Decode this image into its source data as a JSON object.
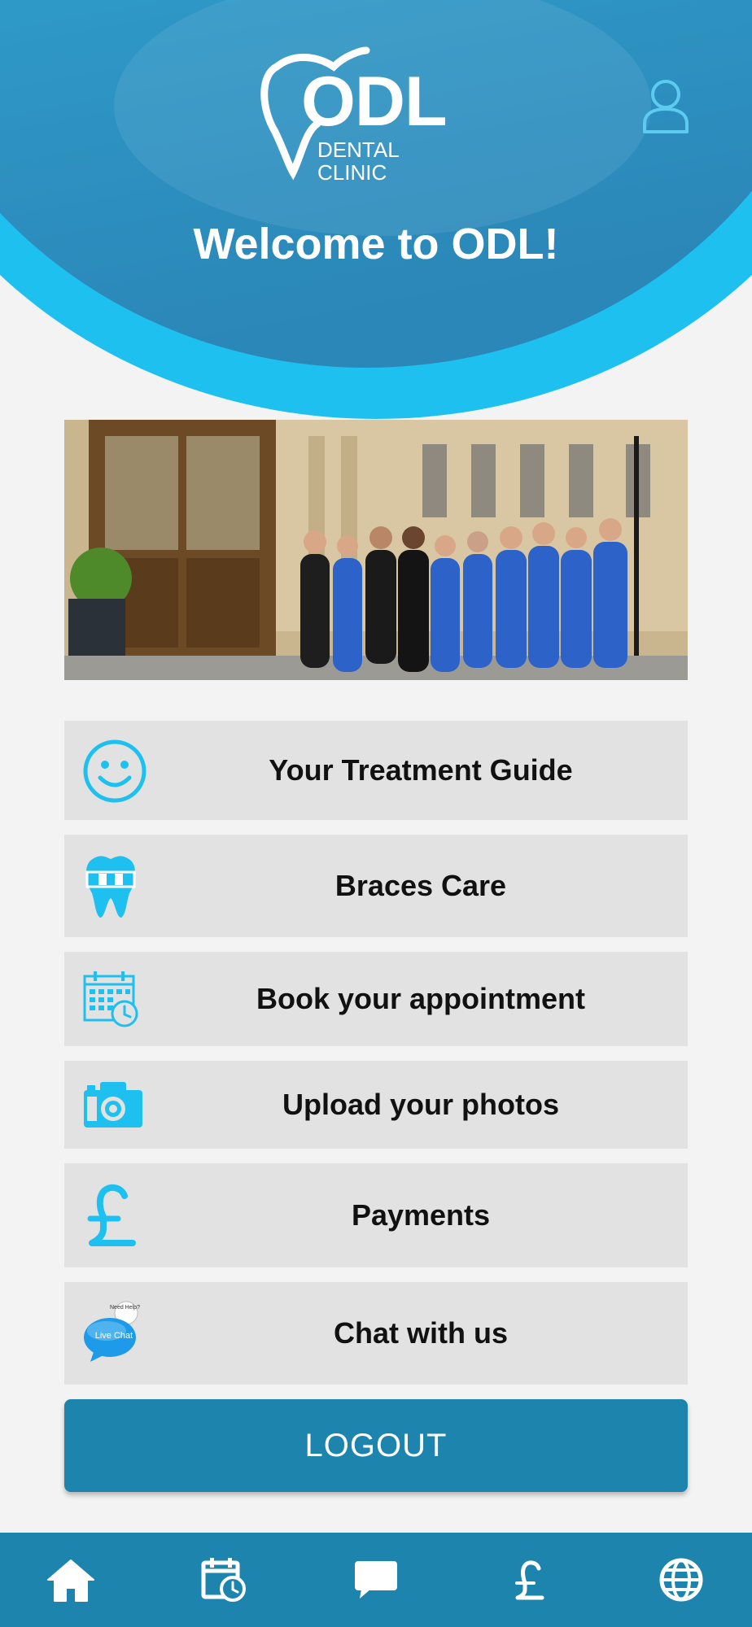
{
  "header": {
    "logo_main": "ODL",
    "logo_sub": "DENTAL CLINIC",
    "welcome": "Welcome to ODL!",
    "profile_icon": "user-profile-icon"
  },
  "menu": [
    {
      "label": "Your Treatment Guide",
      "icon": "smiley-face-icon"
    },
    {
      "label": "Braces Care",
      "icon": "tooth-braces-icon"
    },
    {
      "label": "Book your appointment",
      "icon": "calendar-clock-icon"
    },
    {
      "label": "Upload your photos",
      "icon": "camera-icon"
    },
    {
      "label": "Payments",
      "icon": "pound-sign-icon"
    },
    {
      "label": "Chat with us",
      "icon": "live-chat-icon",
      "badge_text": "Live Chat",
      "badge_top": "Need Help?"
    }
  ],
  "logout_label": "LOGOUT",
  "bottom_nav": [
    {
      "name": "home",
      "icon": "home-icon"
    },
    {
      "name": "appointments",
      "icon": "calendar-clock-icon"
    },
    {
      "name": "chat",
      "icon": "chat-bubble-icon"
    },
    {
      "name": "payments",
      "icon": "pound-sign-icon"
    },
    {
      "name": "website",
      "icon": "globe-icon"
    }
  ],
  "colors": {
    "primary": "#1c84ad",
    "accent": "#1ec0f0",
    "menu_bg": "#e2e2e2",
    "page_bg": "#f3f3f3"
  }
}
